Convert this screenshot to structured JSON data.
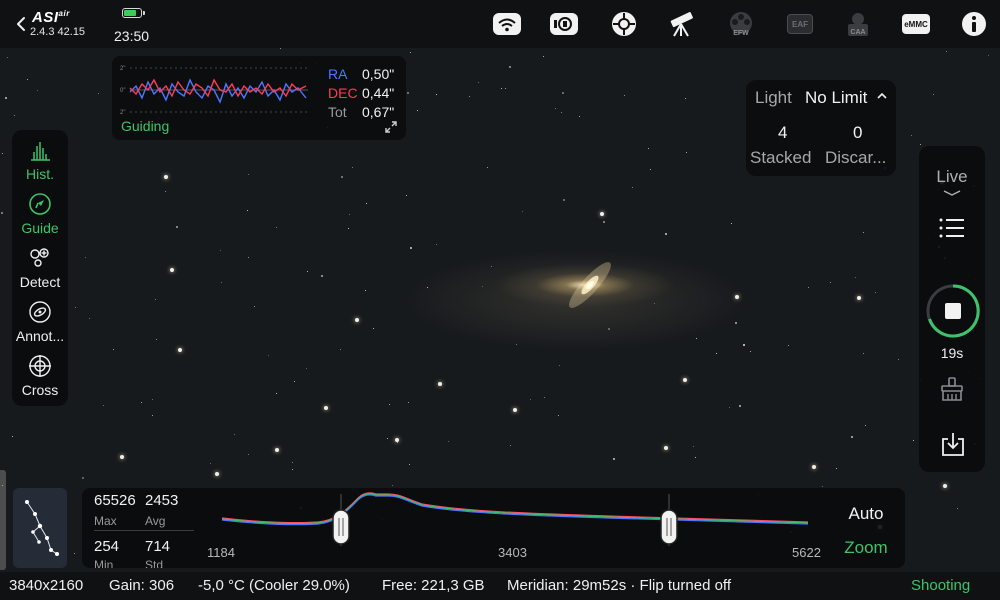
{
  "header": {
    "logo": "ASI",
    "logo_sub": "air",
    "version": "2.4.3 42.15",
    "clock": "23:50",
    "battery_level": 0.8,
    "icons": [
      "wifi-icon",
      "camera-connection-icon",
      "mount-target-icon",
      "telescope-icon",
      "efw-icon",
      "eaf-icon",
      "caa-icon",
      "emmc-icon",
      "info-icon"
    ],
    "efw_label": "EFW",
    "eaf_label": "EAF",
    "caa_label": "CAA",
    "emmc_label": "eMMC"
  },
  "guiding": {
    "title": "Guiding",
    "ra_label": "RA",
    "ra_value": "0,50\"",
    "dec_label": "DEC",
    "dec_value": "0,44\"",
    "tot_label": "Tot",
    "tot_value": "0,67\"",
    "scale_top": "2\"",
    "scale_mid": "0\"",
    "scale_bot": "2\"",
    "colors": {
      "ra": "#4a78ff",
      "dec": "#ff3b55"
    }
  },
  "stack": {
    "frame_type": "Light",
    "frame_limit": "No Limit",
    "stacked_count": "4",
    "stacked_label": "Stacked",
    "discarded_count": "0",
    "discarded_label": "Discar..."
  },
  "left_rail": {
    "items": [
      {
        "label": "Hist.",
        "active": true
      },
      {
        "label": "Guide",
        "active": true
      },
      {
        "label": "Detect",
        "active": false
      },
      {
        "label": "Annot...",
        "active": false
      },
      {
        "label": "Cross",
        "active": false
      }
    ]
  },
  "right_rail": {
    "live_label": "Live",
    "exposure_time": "19s"
  },
  "histogram": {
    "max_value": "65526",
    "max_label": "Max",
    "avg_value": "2453",
    "avg_label": "Avg",
    "min_value": "254",
    "min_label": "Min",
    "std_value": "714",
    "std_label": "Std",
    "tick_left": "1184",
    "tick_mid": "3403",
    "tick_right": "5622",
    "auto_label": "Auto",
    "zoom_label": "Zoom"
  },
  "status": {
    "resolution": "3840x2160",
    "gain": "Gain: 306",
    "temperature": "-5,0 °C (Cooler 29.0%)",
    "free_space": "Free: 221,3 GB",
    "meridian": "Meridian: 29m52s · Flip turned off",
    "state": "Shooting"
  },
  "theme": {
    "accent_green": "#3dc36b",
    "panel_bg": "#0a0b0d"
  }
}
